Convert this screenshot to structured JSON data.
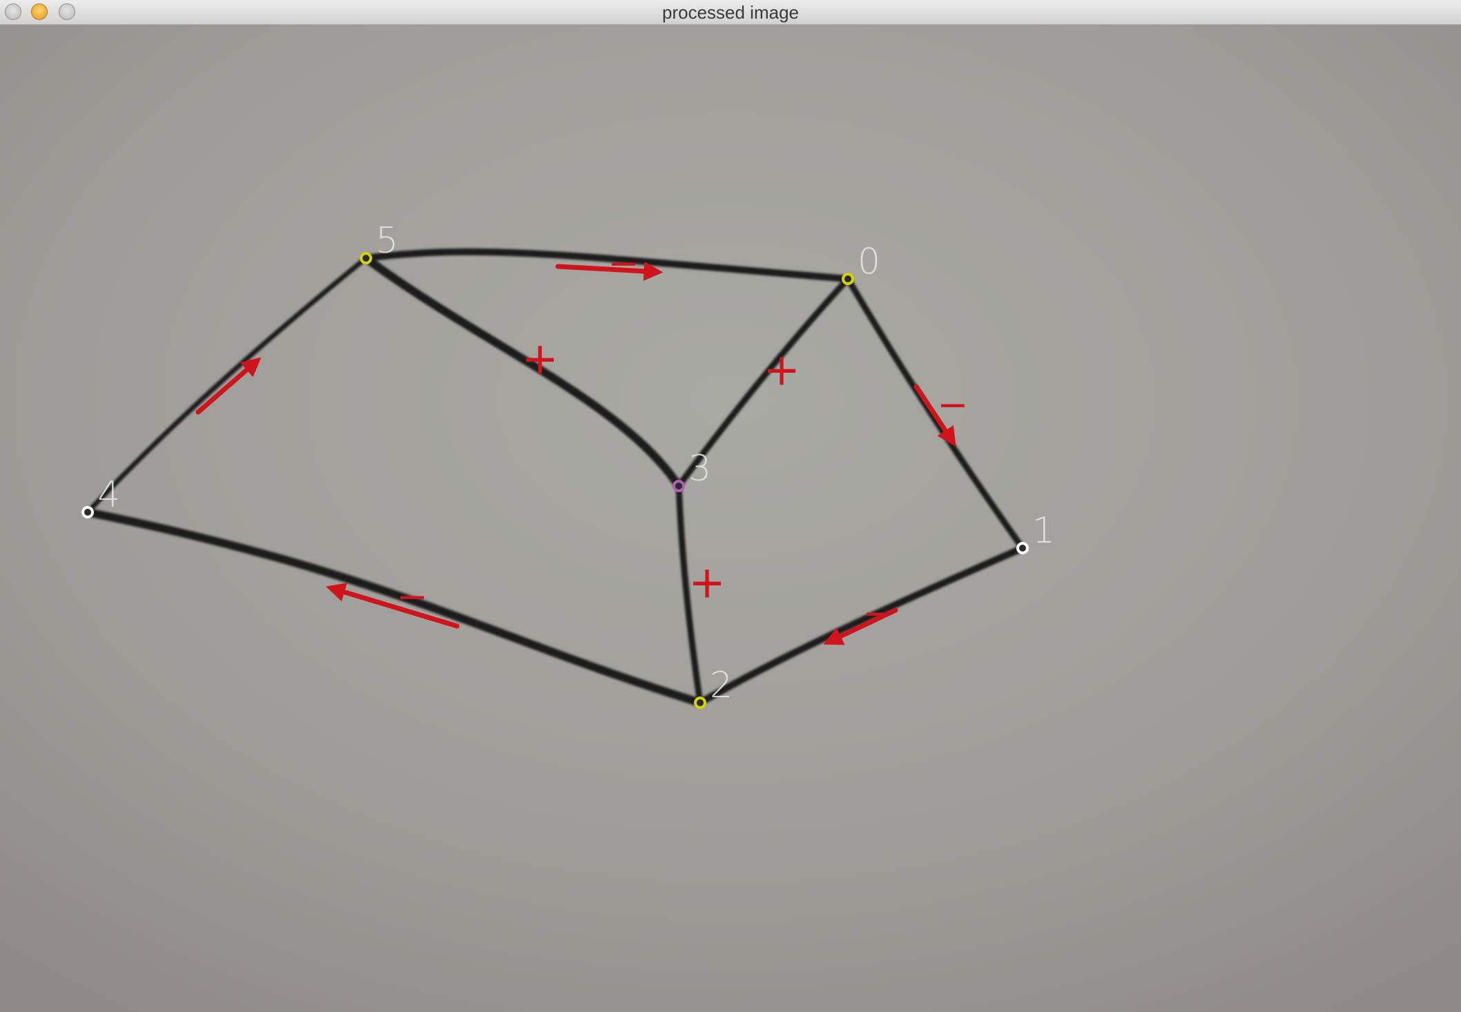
{
  "window": {
    "title": "processed image"
  },
  "graph": {
    "nodes": [
      {
        "label": "0",
        "marker_color": "#d4d400"
      },
      {
        "label": "1",
        "marker_color": "#ffffff"
      },
      {
        "label": "2",
        "marker_color": "#d4d400"
      },
      {
        "label": "3",
        "marker_color": "#b060b0"
      },
      {
        "label": "4",
        "marker_color": "#ffffff"
      },
      {
        "label": "5",
        "marker_color": "#d4d400"
      }
    ],
    "edges": [
      {
        "from": "5",
        "to": "0",
        "sign": "−",
        "arrow": true
      },
      {
        "from": "0",
        "to": "1",
        "sign": "−",
        "arrow": true
      },
      {
        "from": "1",
        "to": "2",
        "sign": "−",
        "arrow": true
      },
      {
        "from": "2",
        "to": "4",
        "sign": "−",
        "arrow": true
      },
      {
        "from": "4",
        "to": "5",
        "sign": "",
        "arrow": true
      },
      {
        "from": "5",
        "to": "3",
        "sign": "+",
        "arrow": false
      },
      {
        "from": "0",
        "to": "3",
        "sign": "+",
        "arrow": false
      },
      {
        "from": "3",
        "to": "2",
        "sign": "+",
        "arrow": false
      }
    ]
  },
  "colors": {
    "annotation": "#d0141b",
    "stroke": "#1a1a1a",
    "label": "#e8e8e8"
  }
}
